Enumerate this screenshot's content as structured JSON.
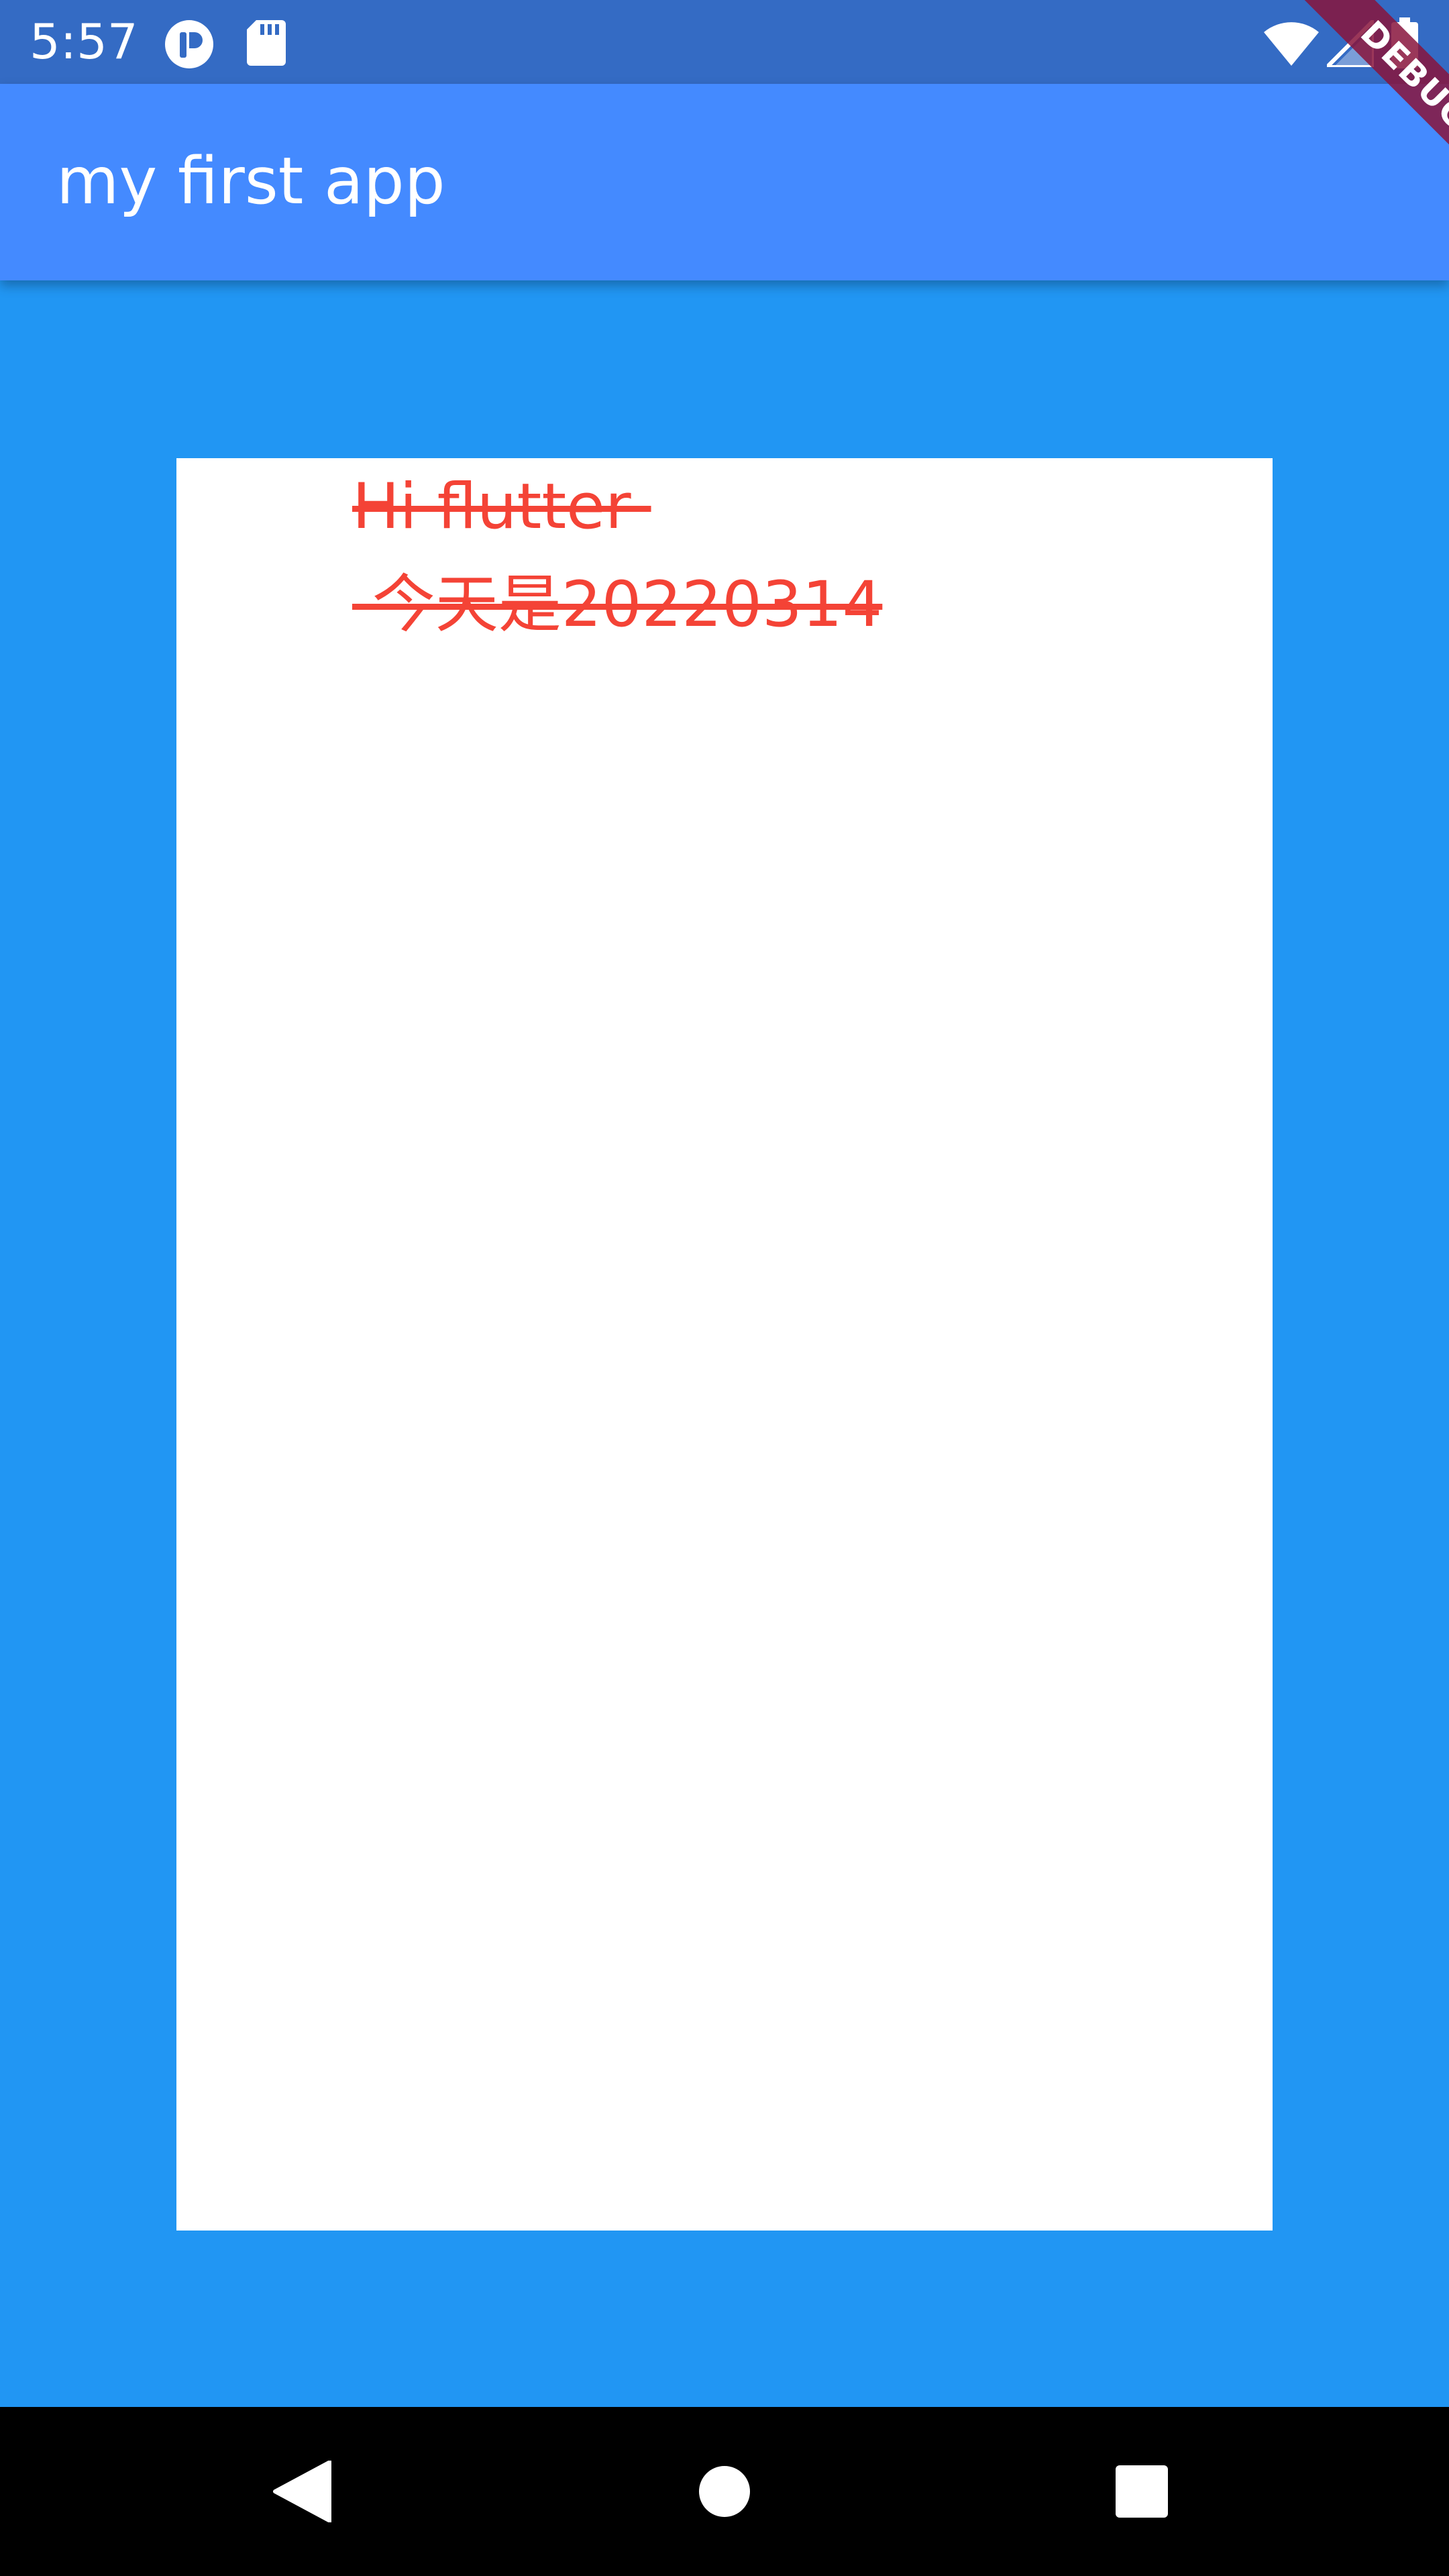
{
  "status_bar": {
    "time": "5:57",
    "icons": [
      "app-notification-icon",
      "sd-card-icon",
      "wifi-icon",
      "cell-signal-icon",
      "battery-icon"
    ]
  },
  "app_bar": {
    "title": "my first app"
  },
  "debug_banner": {
    "label": "DEBUG"
  },
  "card": {
    "text_line_1": "Hi flutter ",
    "text_line_2": " 今天是20220314"
  },
  "nav_bar": {
    "buttons": [
      "back-icon",
      "home-icon",
      "recents-icon"
    ]
  },
  "colors": {
    "status_bar": "#346BC4",
    "app_bar": "#448AFF",
    "background": "#2196F3",
    "card": "#FFFFFF",
    "text": "#F44336",
    "nav_bar": "#000000"
  }
}
